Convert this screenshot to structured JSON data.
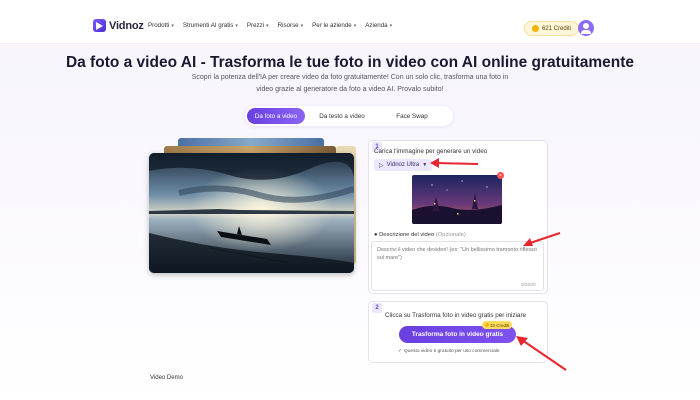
{
  "header": {
    "logo_text": "Vidnoz",
    "nav": [
      {
        "label": "Prodotti"
      },
      {
        "label": "Strumenti AI gratis"
      },
      {
        "label": "Prezzi"
      },
      {
        "label": "Risorse"
      },
      {
        "label": "Per le aziende"
      },
      {
        "label": "Azienda"
      }
    ],
    "credits": "621 Crediti"
  },
  "hero": {
    "title": "Da foto a video AI - Trasforma le tue foto in video con AI online gratuitamente",
    "subtitle": "Scopri la potenza dell'IA per creare video da foto gratuitamente! Con un solo clic, trasforma una foto in video grazie al generatore da foto a video AI. Provalo subito!"
  },
  "tabs": [
    {
      "label": "Da foto a video",
      "active": true
    },
    {
      "label": "Da testo a video",
      "active": false
    },
    {
      "label": "Face Swap",
      "active": false
    }
  ],
  "step1": {
    "number": "1",
    "title": "Carica l'immagine per generare un video",
    "model": "Vidnoz Ultra",
    "description_label": "Descrizione del video",
    "description_optional": "(Opzionale)",
    "description_placeholder": "Descrivi il video che desideri! (es: \"Un bellissimo tramonto riflesso sul mare\")",
    "counter": "0/2000"
  },
  "step2": {
    "number": "2",
    "title": "Clicca su Trasforma foto in video gratis per iniziare",
    "button": "Trasforma foto in video gratis",
    "credit_badge": "10 Crediti",
    "note": "Questo video è gratuito per uso commerciale"
  },
  "footer_label": "Video Demo",
  "colors": {
    "accent": "#6a3fe0",
    "arrow": "#e8262e"
  }
}
